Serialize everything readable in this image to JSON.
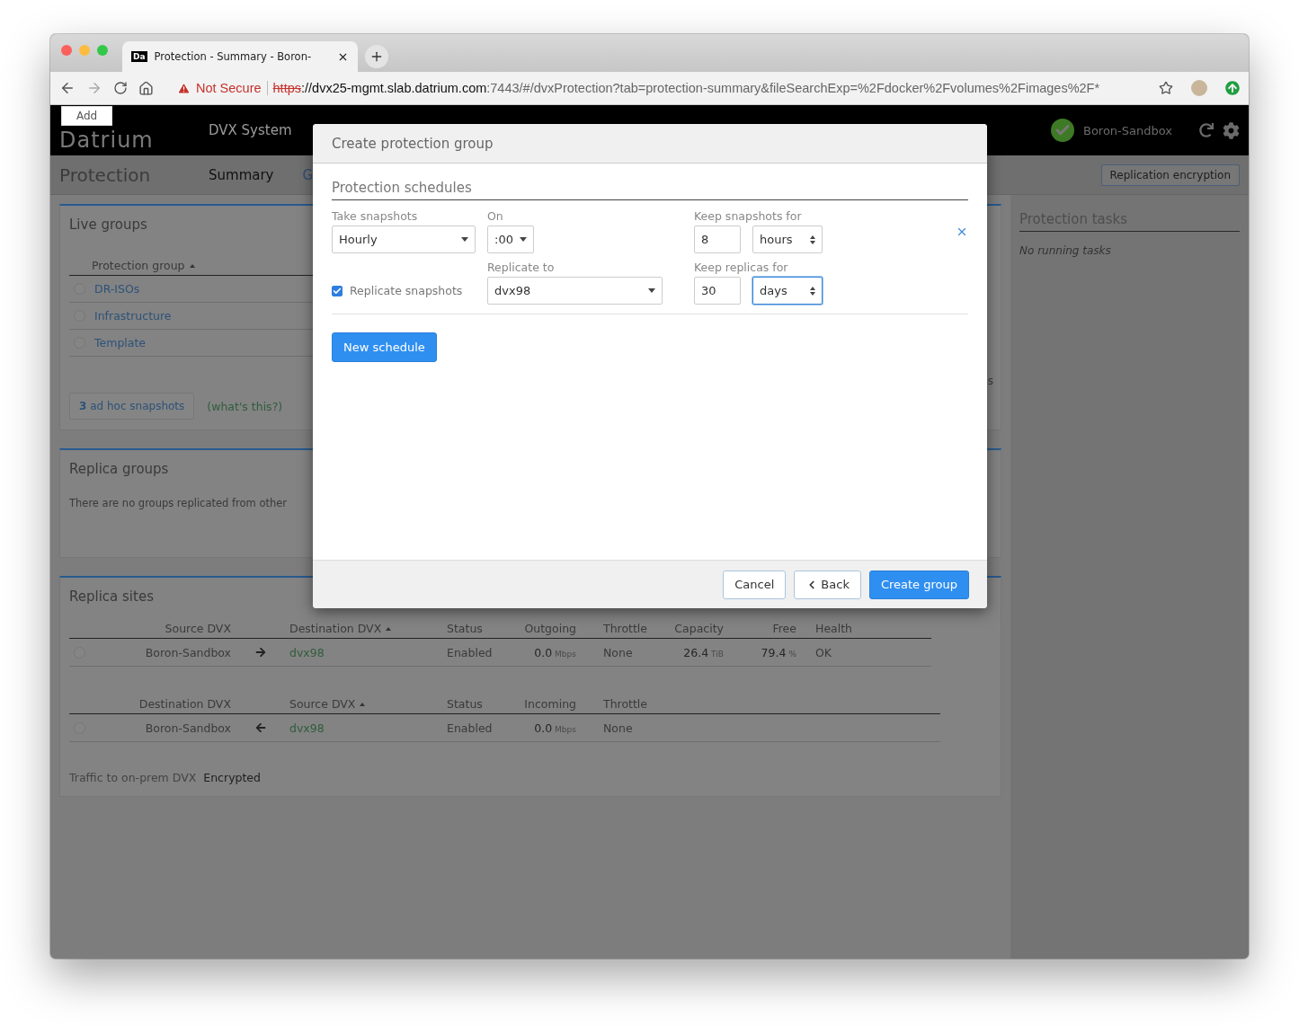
{
  "browser": {
    "tab_favicon": "Da",
    "tab_title": "Protection - Summary - Boron-",
    "url_warning": "Not Secure",
    "url_scheme": "https",
    "url_host": "://dvx25-mgmt.slab.datrium.com",
    "url_rest": ":7443/#/dvxProtection?tab=protection-summary&fileSearchExp=%2Fdocker%2Fvolumes%2Fimages%2F*"
  },
  "tooltip": "Add",
  "header": {
    "logo": "Datrium",
    "nav": "DVX System",
    "system": "Boron-Sandbox"
  },
  "subheader": {
    "title": "Protection",
    "tabs": [
      {
        "label": "Summary",
        "selected": true
      },
      {
        "label": "G",
        "selected": false
      }
    ],
    "button": "Replication encryption"
  },
  "live_groups": {
    "title": "Live groups",
    "column": {
      "label": "Protection group",
      "sorted": true
    },
    "rows": [
      {
        "name": "DR-ISOs",
        "selected": false
      },
      {
        "name": "Infrastructure",
        "selected": false
      },
      {
        "name": "Template",
        "selected": false
      }
    ],
    "adhoc_button": "**3** ad hoc snapshots",
    "help_link": "(what's this?)",
    "fragment": "s"
  },
  "replica_groups": {
    "title": "Replica groups",
    "empty": "There are no groups replicated from other"
  },
  "replica_sites": {
    "title": "Replica sites",
    "outgoing": {
      "columns": [
        {
          "label": "Source DVX",
          "sorted": false
        },
        {
          "label": "Destination DVX",
          "sorted": true
        },
        {
          "label": "Status",
          "sorted": false
        },
        {
          "label": "Outgoing",
          "sorted": false
        },
        {
          "label": "Throttle",
          "sorted": false
        },
        {
          "label": "Capacity",
          "sorted": false
        },
        {
          "label": "Free",
          "sorted": false
        },
        {
          "label": "Health",
          "sorted": false
        }
      ],
      "rows": [
        {
          "selected": false,
          "local": "Boron-Sandbox",
          "remote": "dvx98",
          "status": "Enabled",
          "rate": "0.0",
          "rate_unit": "Mbps",
          "throttle": "None",
          "capacity": "26.4",
          "capacity_unit": "TiB",
          "free": "79.4",
          "free_unit": "%",
          "health": "OK"
        }
      ]
    },
    "incoming": {
      "columns": [
        {
          "label": "Destination DVX",
          "sorted": false
        },
        {
          "label": "Source DVX",
          "sorted": true
        },
        {
          "label": "Status",
          "sorted": false
        },
        {
          "label": "Incoming",
          "sorted": false
        },
        {
          "label": "Throttle",
          "sorted": false
        }
      ],
      "rows": [
        {
          "selected": false,
          "local": "Boron-Sandbox",
          "remote": "dvx98",
          "status": "Enabled",
          "rate": "0.0",
          "rate_unit": "Mbps",
          "throttle": "None"
        }
      ]
    },
    "traffic_label": "Traffic to on-prem DVX",
    "traffic_value": "Encrypted"
  },
  "sidebar": {
    "title": "Protection tasks",
    "empty": "No running tasks"
  },
  "modal": {
    "title": "Create protection group",
    "section": "Protection schedules",
    "schedule": {
      "take_label": "Take snapshots",
      "take": {
        "value": "Hourly",
        "focused": false
      },
      "on_label": "On",
      "on": {
        "value": ":00",
        "focused": false
      },
      "keep_label": "Keep snapshots for",
      "keep_count": {
        "value": "8",
        "focused": false
      },
      "keep_unit": {
        "value": "hours",
        "focused": false
      },
      "replicate": {
        "label": "Replicate snapshots",
        "checked": true
      },
      "replicate_to_label": "Replicate to",
      "replicate_to": {
        "value": "dvx98",
        "focused": false
      },
      "replicas_label": "Keep replicas for",
      "replicas_count": {
        "value": "30",
        "focused": false
      },
      "replicas_unit": {
        "value": "days",
        "focused": true
      }
    },
    "new_schedule": "New schedule",
    "buttons": [
      {
        "label": "Cancel",
        "kind": "default"
      },
      {
        "label": "Back",
        "kind": "back"
      },
      {
        "label": "Create group",
        "kind": "primary"
      }
    ]
  }
}
